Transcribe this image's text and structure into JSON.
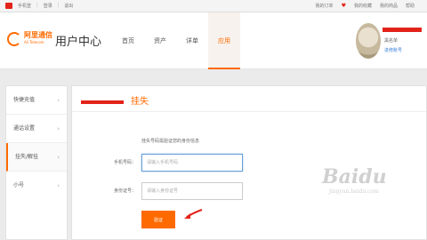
{
  "topbar": {
    "left_items": [
      "手机登",
      "登录",
      "退出"
    ],
    "right_items": [
      "我的订单",
      "我的收藏",
      "我的商品",
      "帮助"
    ]
  },
  "header": {
    "logo_text": "阿里通信",
    "logo_sub": "Ali Telecom",
    "title": "用户中心",
    "nav": [
      "首页",
      "资产",
      "详单",
      "应用"
    ],
    "active_nav": "应用",
    "user_name": "黑名单",
    "user_link": "进修账号"
  },
  "sidebar": {
    "items": [
      "快捷充值",
      "通话设置",
      "挂失/解挂",
      "小号"
    ],
    "active_index": 2
  },
  "panel": {
    "title": "挂失",
    "description": "挂失号码需验证您的身份信息",
    "phone_label": "手机号码：",
    "phone_placeholder": "请输入手机号码",
    "id_label": "身份证号：",
    "id_placeholder": "请输入身份证号",
    "submit_label": "验证"
  },
  "watermark": {
    "main": "Baidu",
    "sub": "jingyan.baidu.com"
  },
  "colors": {
    "accent": "#ff6a00",
    "redaction": "#e2231a",
    "link": "#3a7fd4"
  }
}
